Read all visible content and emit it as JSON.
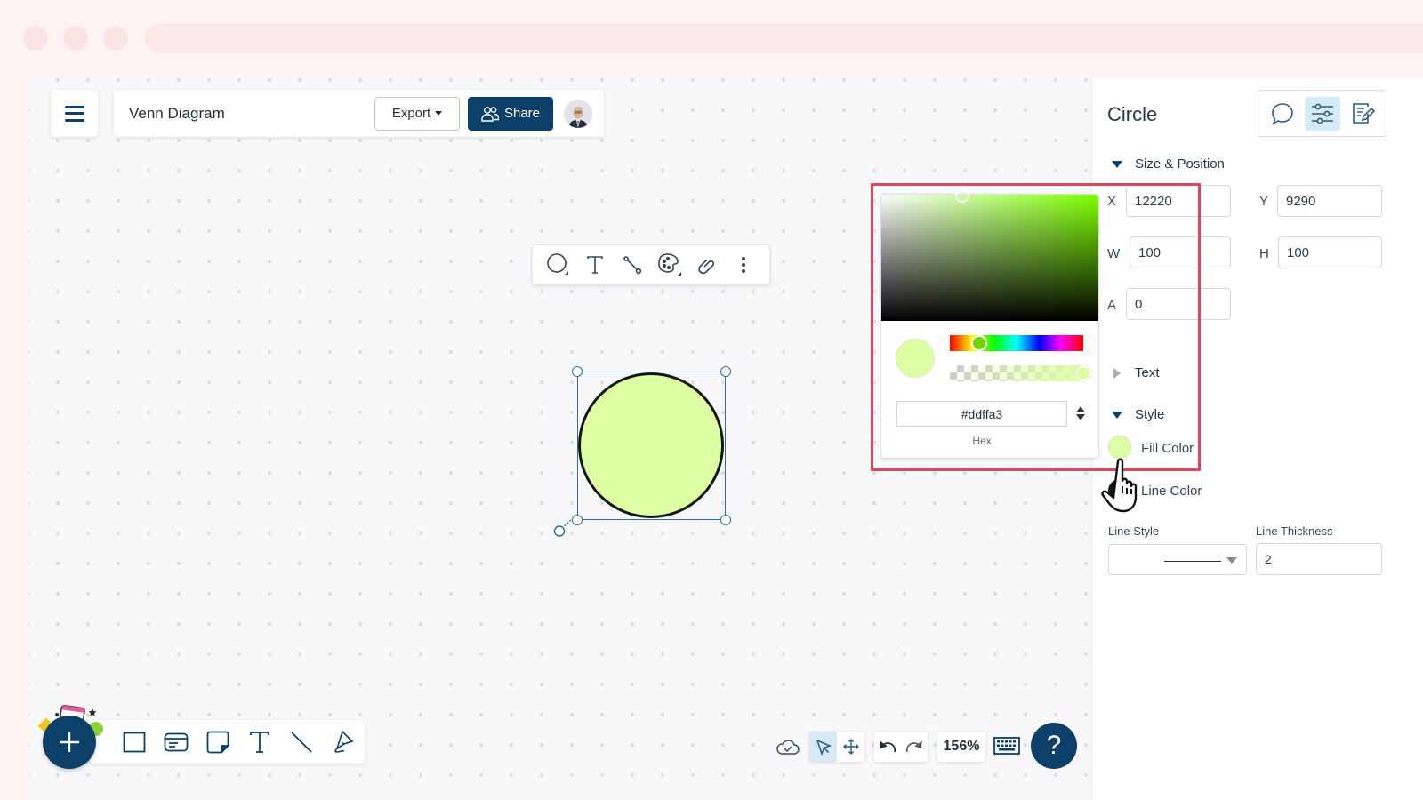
{
  "header": {
    "doc_title": "Venn Diagram",
    "export_label": "Export",
    "share_label": "Share"
  },
  "selection": {
    "shape_fill": "#ddffa3",
    "shape_stroke": "#151515"
  },
  "color_picker": {
    "hex_value": "#ddffa3",
    "hex_label": "Hex",
    "hue_fraction": 0.22,
    "alpha_fraction": 1.0
  },
  "panel": {
    "title": "Circle",
    "tabs": [
      {
        "icon": "comment-icon",
        "active": false
      },
      {
        "icon": "sliders-icon",
        "active": true
      },
      {
        "icon": "edit-note-icon",
        "active": false
      }
    ],
    "size_position": {
      "label": "Size & Position",
      "x_label": "X",
      "x": "12220",
      "y_label": "Y",
      "y": "9290",
      "w_label": "W",
      "w": "100",
      "h_label": "H",
      "h": "100",
      "a_label": "A",
      "a": "0"
    },
    "text_section": "Text",
    "style_section": "Style",
    "fill_color_label": "Fill Color",
    "line_color_label": "Line Color",
    "line_style_label": "Line Style",
    "line_thickness_label": "Line Thickness",
    "line_thickness": "2"
  },
  "bottom_bar": {
    "zoom_level": "156%",
    "help_label": "?"
  },
  "colors": {
    "brand": "#0c4068",
    "highlight": "#d9485f",
    "active_tab_bg": "#d6e9f7"
  }
}
